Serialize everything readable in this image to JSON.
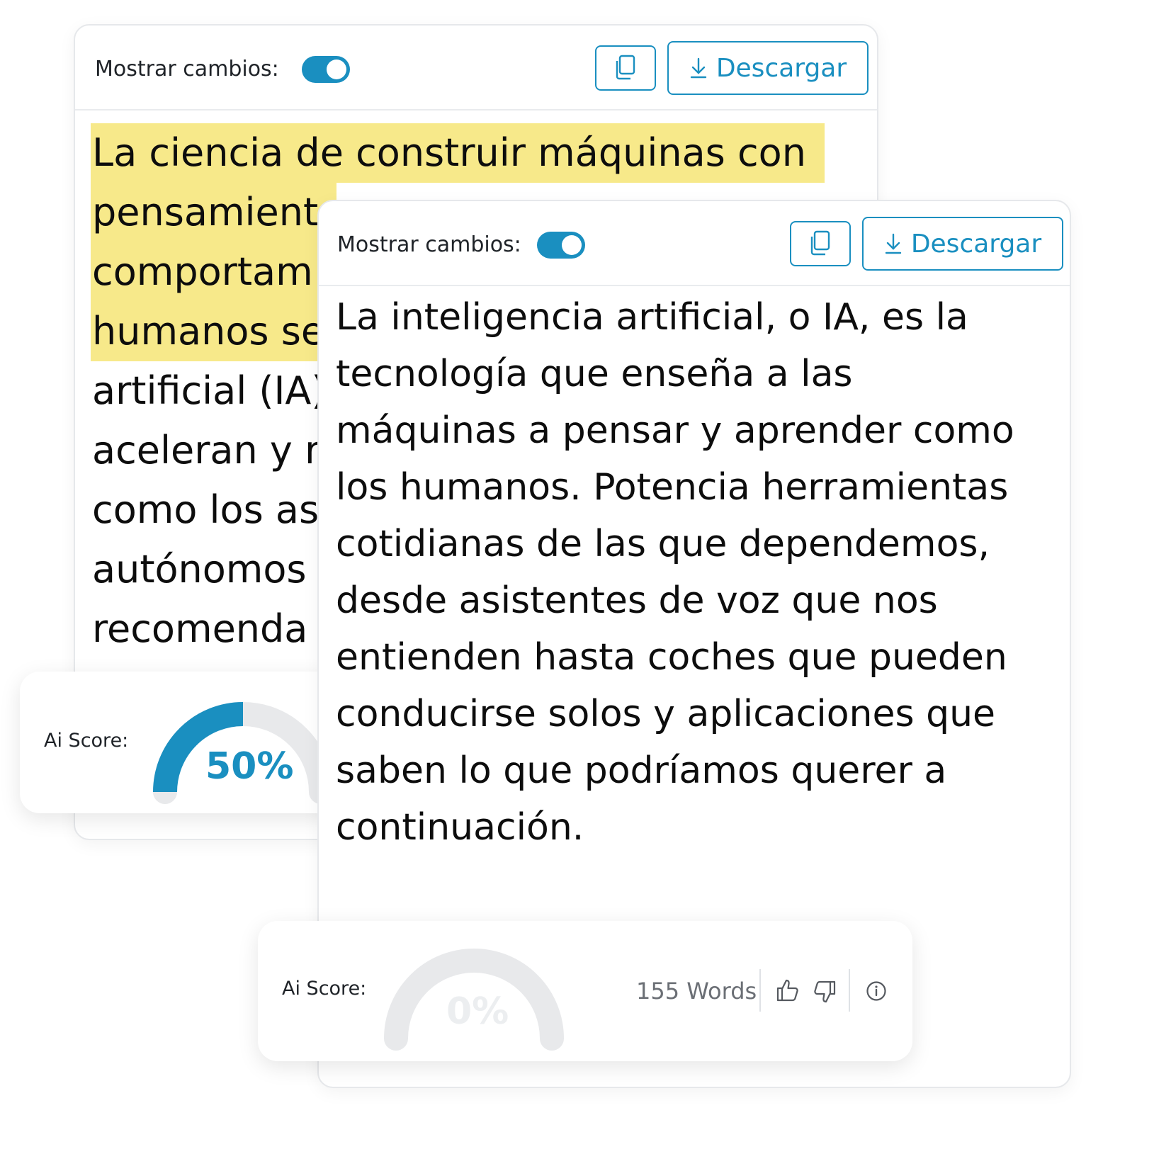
{
  "back_panel": {
    "show_changes_label": "Mostrar cambios:",
    "download_label": "Descargar",
    "highlighted_lines": [
      "La ciencia de construir máquinas con",
      "pensamient",
      "comportam",
      "humanos se"
    ],
    "plain_lines": [
      "artificial (IA)",
      "aceleran y r",
      "como los as",
      "autónomos",
      "recomenda"
    ],
    "score": {
      "label": "Ai Score:",
      "value_text": "50%",
      "percent": 50
    }
  },
  "front_panel": {
    "show_changes_label": "Mostrar cambios:",
    "download_label": "Descargar",
    "lines": [
      "La inteligencia artificial, o IA, es la",
      "tecnología que enseña a las",
      "máquinas a pensar y aprender como",
      "los humanos. Potencia herramientas",
      "cotidianas de las que dependemos,",
      "desde asistentes de voz que nos",
      "entienden hasta coches que pueden",
      "conducirse solos y aplicaciones que",
      "saben lo que podríamos querer a",
      "continuación."
    ],
    "score": {
      "label": "Ai Score:",
      "value_text": "0%",
      "percent": 0
    },
    "word_count": "155 Words"
  },
  "colors": {
    "accent": "#1a8fc0",
    "highlight": "#f7e98a",
    "gauge_track": "#e8e9eb"
  },
  "icons": [
    "copy-icon",
    "download-icon",
    "thumbs-up-icon",
    "thumbs-down-icon",
    "info-icon"
  ]
}
